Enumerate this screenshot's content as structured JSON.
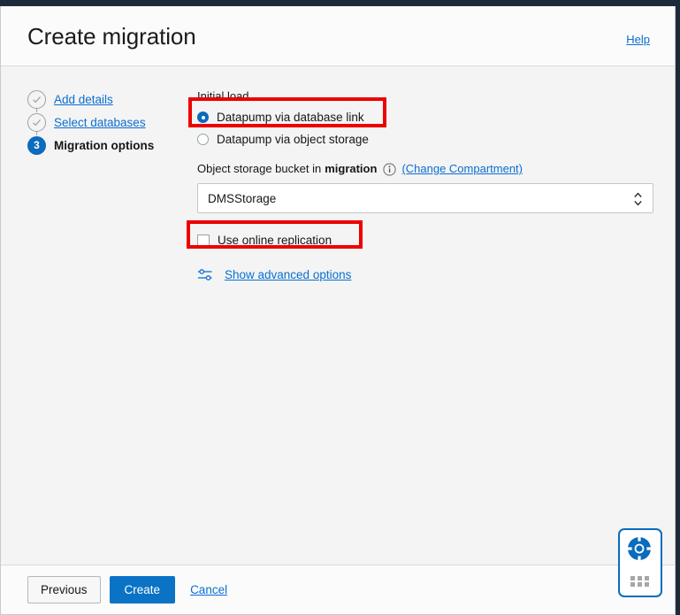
{
  "window": {
    "title": "Create migration",
    "help_link": "Help"
  },
  "steps": [
    {
      "label": "Add details",
      "marker": "check",
      "state": "done"
    },
    {
      "label": "Select databases",
      "marker": "check",
      "state": "done"
    },
    {
      "label": "Migration options",
      "marker": "3",
      "state": "current"
    }
  ],
  "form": {
    "initial_load": {
      "label": "Initial load",
      "options": [
        {
          "label": "Datapump via database link",
          "selected": true
        },
        {
          "label": "Datapump via object storage",
          "selected": false
        }
      ]
    },
    "bucket": {
      "caption_prefix": "Object storage bucket in",
      "caption_strong": "migration",
      "info_icon": "info-icon",
      "change_compartment_link": "(Change Compartment)",
      "selected_value": "DMSStorage"
    },
    "online_replication": {
      "label": "Use online replication",
      "checked": false
    },
    "advanced": {
      "icon": "sliders-icon",
      "label": "Show advanced options"
    }
  },
  "footer": {
    "previous_label": "Previous",
    "create_label": "Create",
    "cancel_label": "Cancel"
  },
  "help_widget": {
    "icon": "lifebuoy-icon",
    "grid_icon": "grid-dots-icon"
  },
  "colors": {
    "accent_blue": "#0b6bbd",
    "link_blue": "#0a6ed1",
    "annotation_red": "#ec0000",
    "topbar_navy": "#1c2b39"
  }
}
